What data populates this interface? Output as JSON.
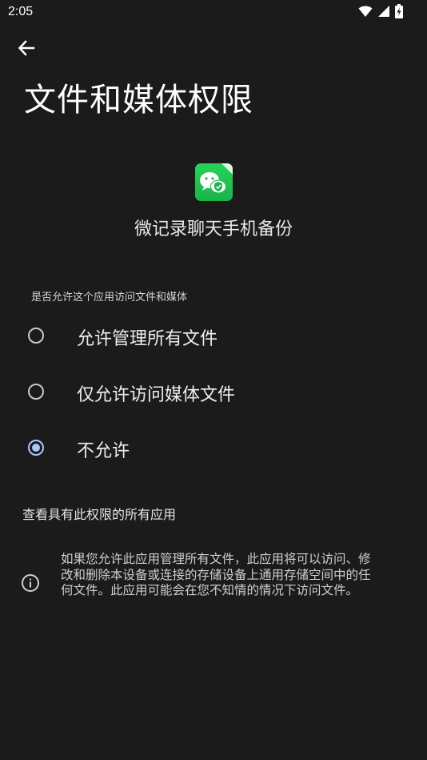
{
  "status_bar": {
    "time": "2:05",
    "icons": [
      "wifi-icon",
      "cellular-signal-icon",
      "battery-charging-icon"
    ]
  },
  "header": {
    "title": "文件和媒体权限",
    "back_icon": "arrow-left-icon"
  },
  "app": {
    "name": "微记录聊天手机备份",
    "icon_color": "#1fc651"
  },
  "permission": {
    "question": "是否允许这个应用访问文件和媒体",
    "options": [
      {
        "label": "允许管理所有文件",
        "selected": false
      },
      {
        "label": "仅允许访问媒体文件",
        "selected": false
      },
      {
        "label": "不允许",
        "selected": true
      }
    ]
  },
  "links": {
    "see_all": "查看具有此权限的所有应用"
  },
  "info": {
    "icon": "info-icon",
    "text": "如果您允许此应用管理所有文件，此应用将可以访问、修改和删除本设备或连接的存储设备上通用存储空间中的任何文件。此应用可能会在您不知情的情况下访问文件。"
  },
  "colors": {
    "background": "#1b1b1b",
    "accent": "#aac7ff",
    "text": "#e6e6e6"
  }
}
